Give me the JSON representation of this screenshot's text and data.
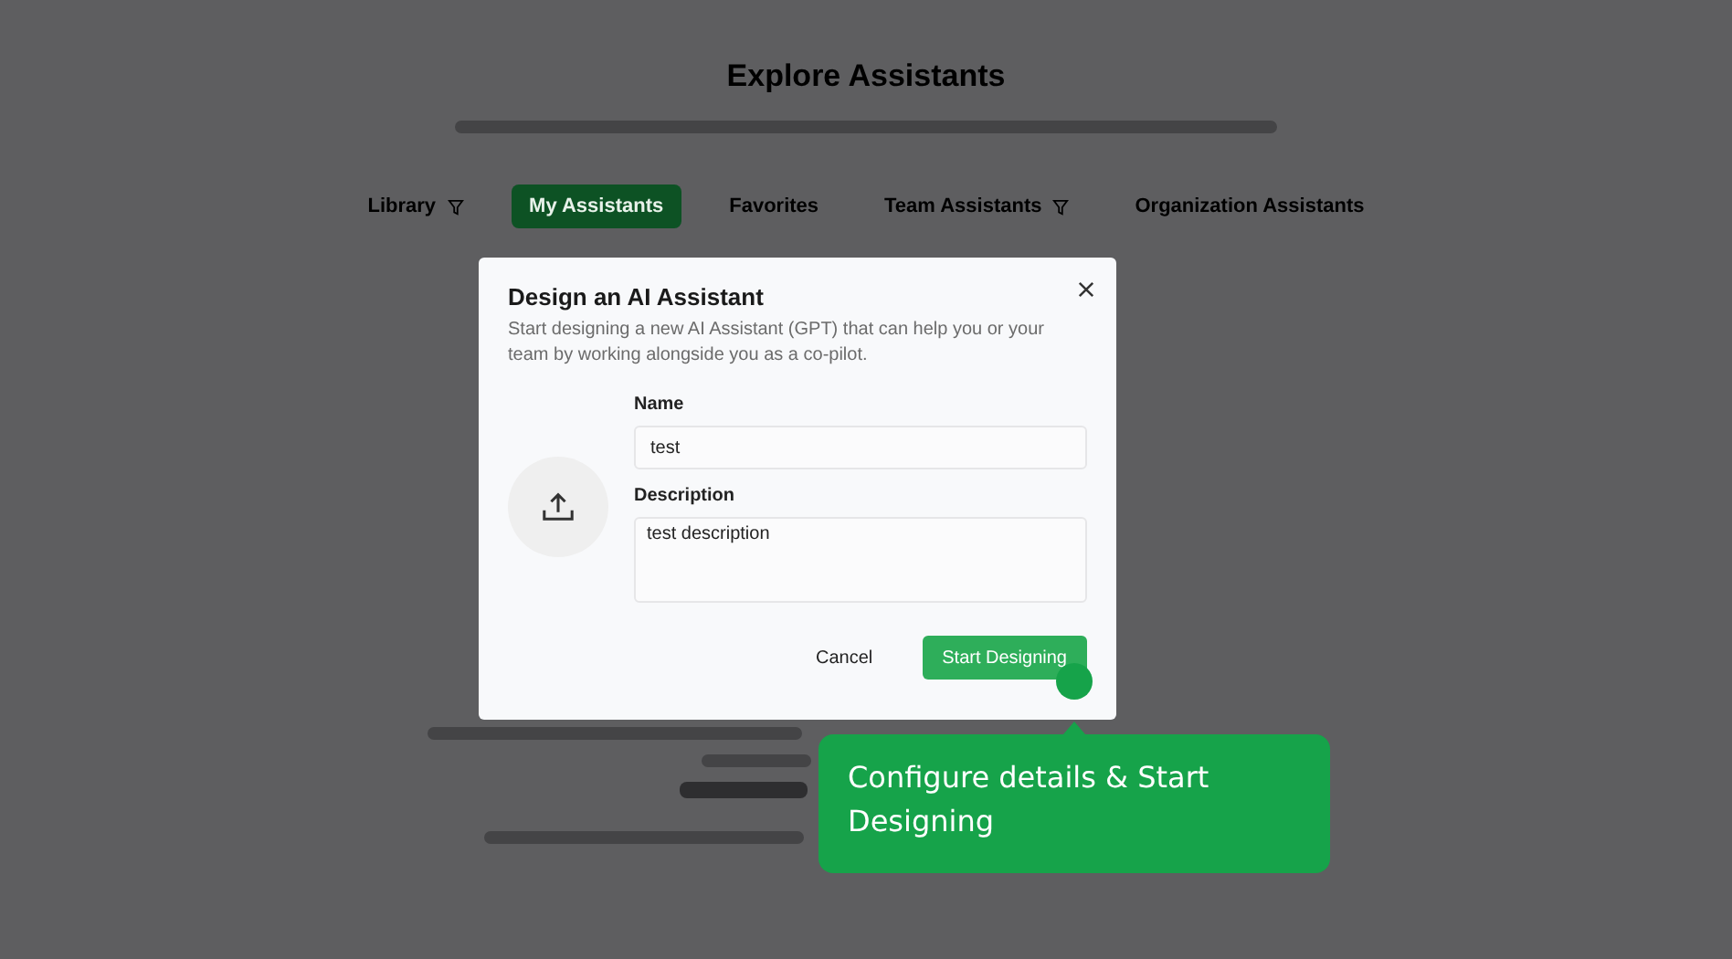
{
  "page": {
    "title": "Explore Assistants",
    "tabs": [
      {
        "label": "Library",
        "selected": false,
        "dropdown": true
      },
      {
        "label": "My Assistants",
        "selected": true,
        "dropdown": false
      },
      {
        "label": "Favorites",
        "selected": false,
        "dropdown": false
      },
      {
        "label": "Team Assistants",
        "selected": false,
        "dropdown": true
      },
      {
        "label": "Organization Assistants",
        "selected": false,
        "dropdown": false
      }
    ]
  },
  "dialog": {
    "title": "Design an AI Assistant",
    "description": "Start designing a new AI Assistant (GPT) that can help you or your team by working alongside you as a co-pilot.",
    "fields": [
      {
        "label": "Name",
        "value": "test",
        "kind": "input"
      },
      {
        "label": "Description",
        "value": "test description",
        "kind": "textarea"
      }
    ],
    "buttons": [
      {
        "label": "Cancel",
        "kind": "text"
      },
      {
        "label": "Start Designing",
        "kind": "primary"
      }
    ]
  },
  "tooltip": {
    "text": "Configure details & Start Designing"
  }
}
